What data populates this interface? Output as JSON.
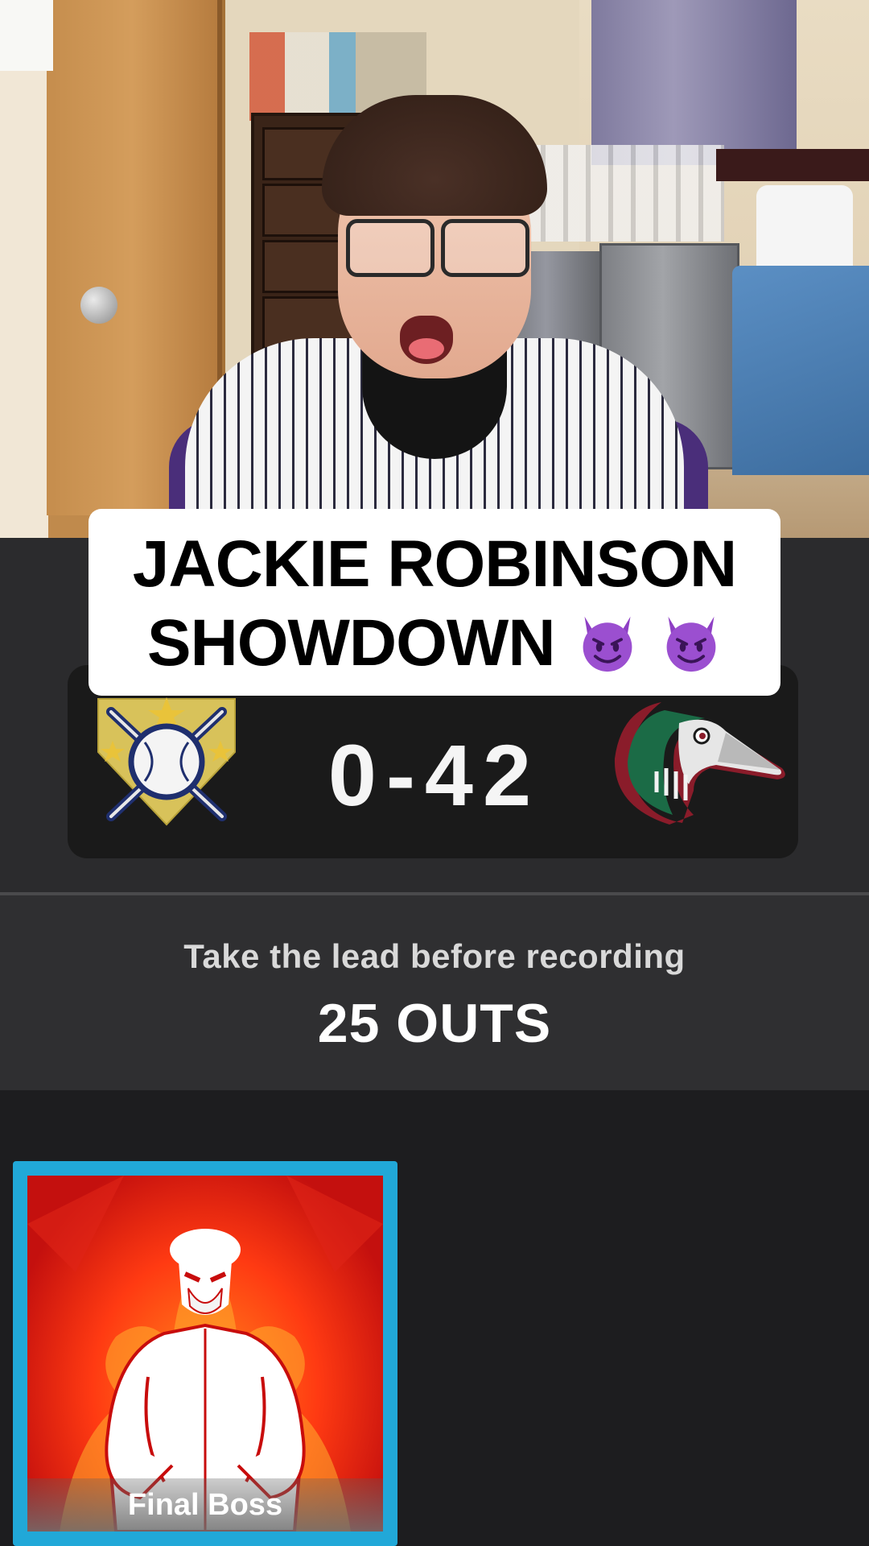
{
  "overlay": {
    "title_line1": "JACKIE ROBINSON",
    "title_line2": "SHOWDOWN",
    "emoji": "smiling-face-with-horns-icon"
  },
  "scoreboard": {
    "home_logo": "crossed-bats-baseball-logo",
    "away_logo": "loon-bird-logo",
    "score": "0-42"
  },
  "objective": {
    "line1": "Take the lead before recording",
    "line2": "25 OUTS"
  },
  "card": {
    "label": "Final Boss",
    "border_color": "#21a8d8"
  },
  "colors": {
    "panel_bg": "#1a1a1a",
    "ui_bg": "#2b2b2d",
    "card_fire": "#ff3a12"
  }
}
